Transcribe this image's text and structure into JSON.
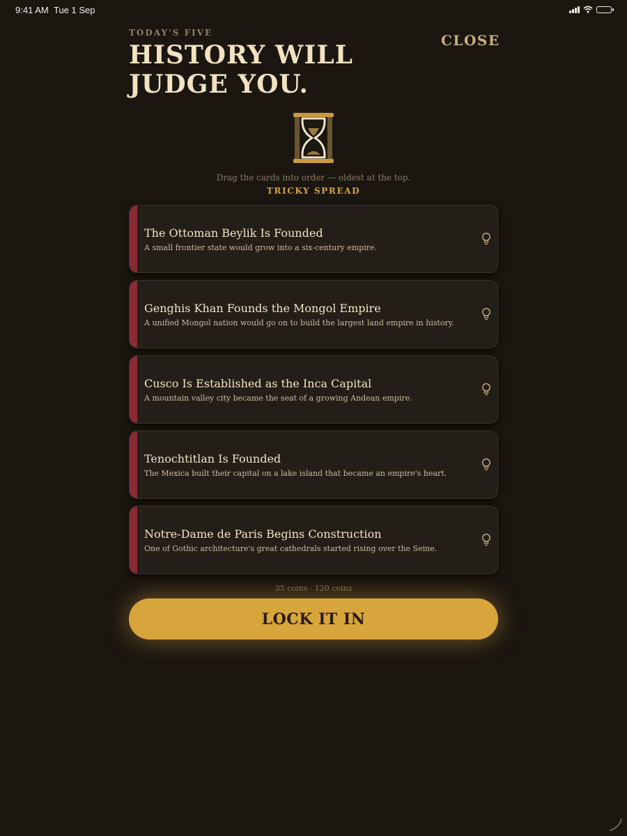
{
  "status_bar": {
    "time": "9:41 AM",
    "date": "Tue 1 Sep"
  },
  "header": {
    "kicker": "TODAY'S FIVE",
    "title": "HISTORY WILL JUDGE YOU.",
    "close_label": "CLOSE"
  },
  "instruction": "Drag the cards into order — oldest at the top.",
  "difficulty_label": "TRICKY SPREAD",
  "cards": [
    {
      "title": "The Ottoman Beylik Is Founded",
      "subtitle": "A small frontier state would grow into a six-century empire."
    },
    {
      "title": "Genghis Khan Founds the Mongol Empire",
      "subtitle": "A unified Mongol nation would go on to build the largest land empire in history."
    },
    {
      "title": "Cusco Is Established as the Inca Capital",
      "subtitle": "A mountain valley city became the seat of a growing Andean empire."
    },
    {
      "title": "Tenochtitlan Is Founded",
      "subtitle": "The Mexica built their capital on a lake island that became an empire's heart."
    },
    {
      "title": "Notre-Dame de Paris Begins Construction",
      "subtitle": "One of Gothic architecture's great cathedrals started rising over the Seine."
    }
  ],
  "coins_text": "35 coins · 120 coins",
  "submit_label": "LOCK IT IN",
  "icons": {
    "hourglass": "hourglass-icon",
    "hint": "lightbulb-icon",
    "wifi": "wifi-icon",
    "signal": "cellular-signal-icon",
    "battery": "battery-charging-icon"
  },
  "colors": {
    "background": "#1b1610",
    "card_background": "#241e18",
    "card_accent": "#8a2a35",
    "gold": "#d8a53c",
    "title": "#f1e2c0"
  }
}
